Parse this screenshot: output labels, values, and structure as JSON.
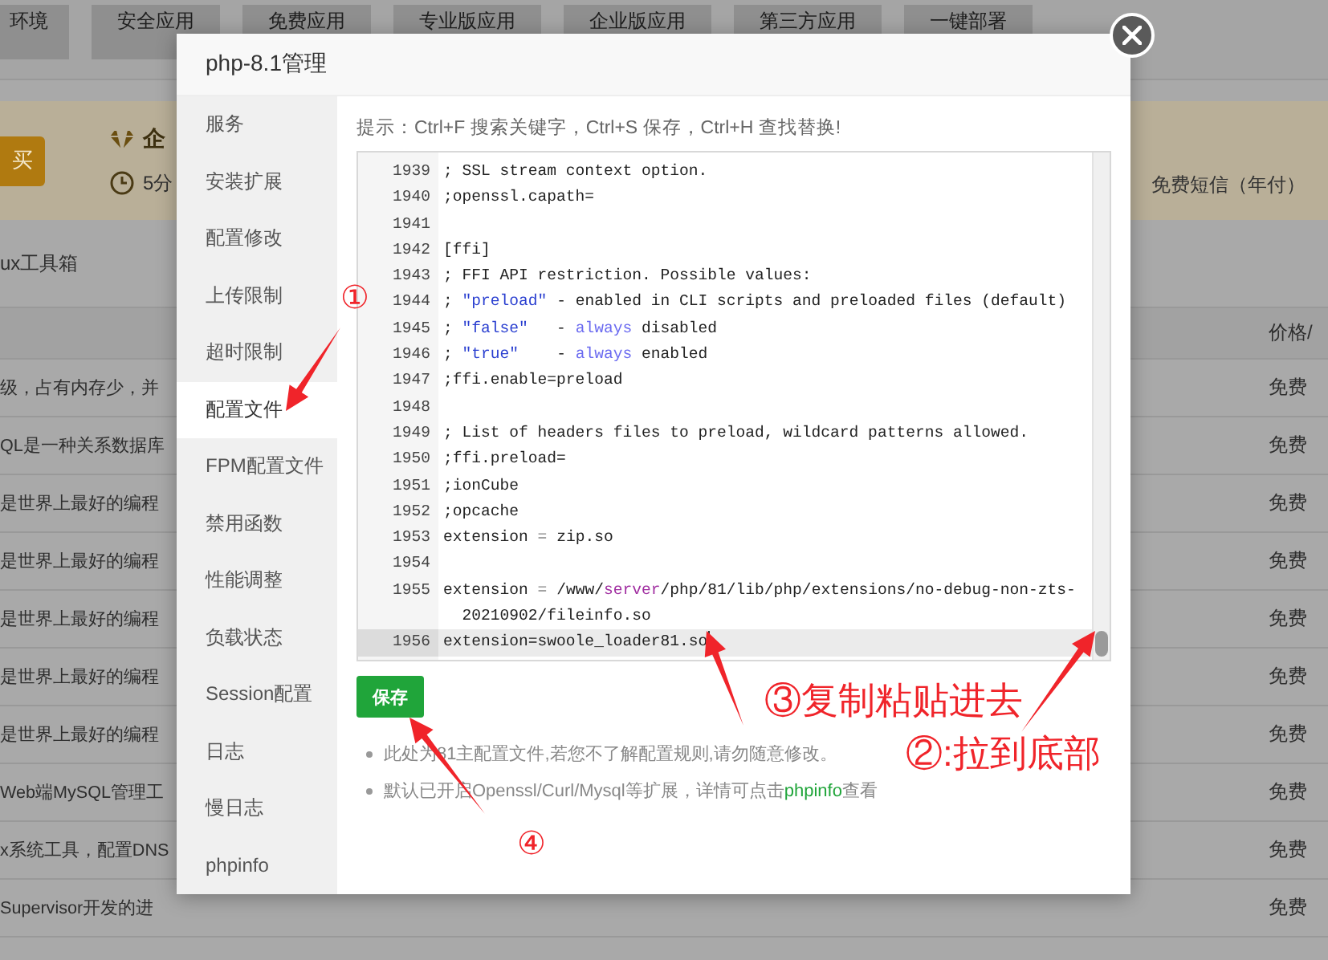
{
  "background": {
    "tabs": [
      "环境",
      "安全应用",
      "免费应用",
      "专业版应用",
      "企业版应用",
      "第三方应用",
      "一键部署"
    ],
    "banner": {
      "buy_button": "买",
      "title": "企",
      "subtitle": "5分",
      "note": "免费短信（年付）"
    },
    "toolbox": "ux工具箱",
    "table": {
      "columns": [
        "价格/"
      ],
      "rows": [
        {
          "description": "级，占有内存少，并",
          "price": "免费"
        },
        {
          "description": "QL是一种关系数据库",
          "price": "免费"
        },
        {
          "description": "是世界上最好的编程",
          "price": "免费"
        },
        {
          "description": "是世界上最好的编程",
          "price": "免费"
        },
        {
          "description": "是世界上最好的编程",
          "price": "免费"
        },
        {
          "description": "是世界上最好的编程",
          "price": "免费"
        },
        {
          "description": "是世界上最好的编程",
          "price": "免费"
        },
        {
          "description": "Web端MySQL管理工",
          "price": "免费"
        },
        {
          "description": "x系统工具，配置DNS",
          "price": "免费"
        },
        {
          "description": "Supervisor开发的进",
          "price": "免费"
        }
      ]
    }
  },
  "modal": {
    "title": "php-8.1管理",
    "sidebar": [
      {
        "label": "服务",
        "selected": false
      },
      {
        "label": "安装扩展",
        "selected": false
      },
      {
        "label": "配置修改",
        "selected": false
      },
      {
        "label": "上传限制",
        "selected": false
      },
      {
        "label": "超时限制",
        "selected": false
      },
      {
        "label": "配置文件",
        "selected": true
      },
      {
        "label": "FPM配置文件",
        "selected": false
      },
      {
        "label": "禁用函数",
        "selected": false
      },
      {
        "label": "性能调整",
        "selected": false
      },
      {
        "label": "负载状态",
        "selected": false
      },
      {
        "label": "Session配置",
        "selected": false
      },
      {
        "label": "日志",
        "selected": false
      },
      {
        "label": "慢日志",
        "selected": false
      },
      {
        "label": "phpinfo",
        "selected": false
      }
    ],
    "hint": "提示：Ctrl+F 搜索关键字，Ctrl+S 保存，Ctrl+H 查找替换!",
    "editor": {
      "lines": [
        {
          "number": "1939",
          "active": false,
          "segments": [
            {
              "kind": "plain",
              "text": "; SSL stream context option."
            }
          ]
        },
        {
          "number": "1940",
          "active": false,
          "segments": [
            {
              "kind": "plain",
              "text": ";openssl.capath="
            }
          ]
        },
        {
          "number": "1941",
          "active": false
        },
        {
          "number": "1942",
          "active": false,
          "segments": [
            {
              "kind": "plain",
              "text": "[ffi]"
            }
          ]
        },
        {
          "number": "1943",
          "active": false,
          "segments": [
            {
              "kind": "plain",
              "text": "; FFI API restriction. Possible values:"
            }
          ]
        },
        {
          "number": "1944",
          "active": false,
          "segments": [
            {
              "kind": "plain",
              "text": "; "
            },
            {
              "kind": "string",
              "text": "\"preload\""
            },
            {
              "kind": "plain",
              "text": " - enabled in CLI scripts and preloaded files (default)"
            }
          ]
        },
        {
          "number": "1945",
          "active": false,
          "segments": [
            {
              "kind": "plain",
              "text": "; "
            },
            {
              "kind": "string",
              "text": "\"false\""
            },
            {
              "kind": "plain",
              "text": "   - "
            },
            {
              "kind": "keyword",
              "text": "always"
            },
            {
              "kind": "plain",
              "text": " disabled"
            }
          ]
        },
        {
          "number": "1946",
          "active": false,
          "segments": [
            {
              "kind": "plain",
              "text": "; "
            },
            {
              "kind": "string",
              "text": "\"true\""
            },
            {
              "kind": "plain",
              "text": "    - "
            },
            {
              "kind": "keyword",
              "text": "always"
            },
            {
              "kind": "plain",
              "text": " enabled"
            }
          ]
        },
        {
          "number": "1947",
          "active": false,
          "segments": [
            {
              "kind": "plain",
              "text": ";ffi.enable=preload"
            }
          ]
        },
        {
          "number": "1948",
          "active": false
        },
        {
          "number": "1949",
          "active": false,
          "segments": [
            {
              "kind": "plain",
              "text": "; List of headers files to preload, wildcard patterns allowed."
            }
          ]
        },
        {
          "number": "1950",
          "active": false,
          "segments": [
            {
              "kind": "plain",
              "text": ";ffi.preload="
            }
          ]
        },
        {
          "number": "1951",
          "active": false,
          "segments": [
            {
              "kind": "plain",
              "text": ";ionCube"
            }
          ]
        },
        {
          "number": "1952",
          "active": false,
          "segments": [
            {
              "kind": "plain",
              "text": ";opcache"
            }
          ]
        },
        {
          "number": "1953",
          "active": false,
          "segments": [
            {
              "kind": "plain",
              "text": "extension "
            },
            {
              "kind": "operator",
              "text": "="
            },
            {
              "kind": "plain",
              "text": " zip.so"
            }
          ]
        },
        {
          "number": "1954",
          "active": false
        },
        {
          "number": "1955",
          "active": false,
          "segments": [
            {
              "kind": "plain",
              "text": "extension "
            },
            {
              "kind": "operator",
              "text": "="
            },
            {
              "kind": "plain",
              "text": " /www/"
            },
            {
              "kind": "variable",
              "text": "server"
            },
            {
              "kind": "plain",
              "text": "/php/81/lib/php/extensions/no-debug-non-zts-20210902/fileinfo.so"
            }
          ]
        },
        {
          "number": "1956",
          "active": true,
          "segments": [
            {
              "kind": "plain",
              "text": "extension=swoole_loader81.so"
            }
          ]
        }
      ]
    },
    "save_button": "保存",
    "notes": [
      {
        "text": "此处为81主配置文件,若您不了解配置规则,请勿随意修改。"
      },
      {
        "text": "默认已开启Openssl/Curl/Mysql等扩展，详情可点击",
        "link": "phpinfo",
        "after": "查看"
      }
    ]
  },
  "annotations": [
    {
      "text": "①"
    },
    {
      "text": "③复制粘贴进去"
    },
    {
      "text": "②:拉到底部"
    },
    {
      "text": "④"
    }
  ]
}
